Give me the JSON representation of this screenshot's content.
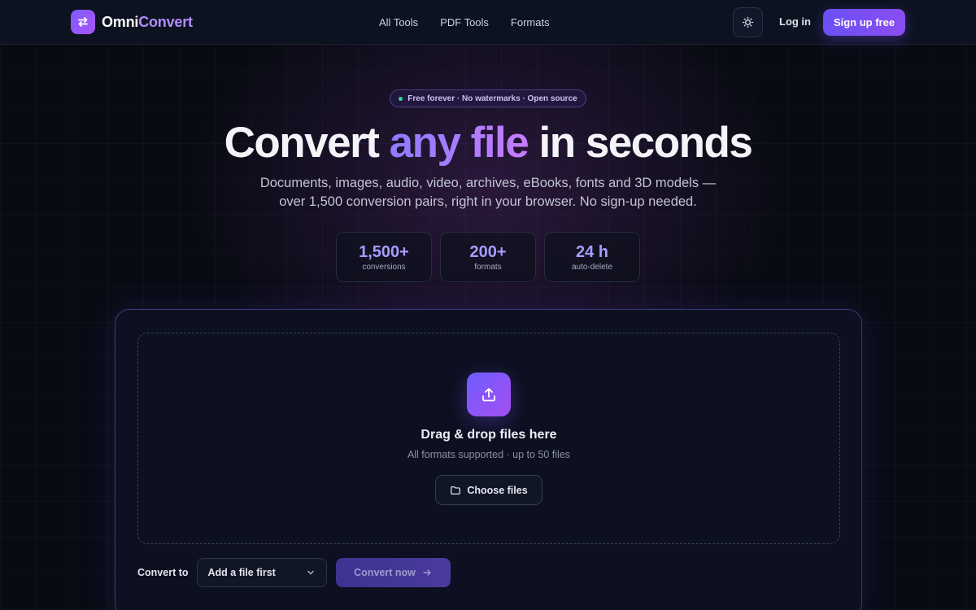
{
  "brand": {
    "name_part1": "Omni",
    "name_part2": "Convert",
    "logo_icon": "swap-arrows-icon"
  },
  "nav": {
    "links": [
      "All Tools",
      "PDF Tools",
      "Formats"
    ]
  },
  "header": {
    "theme_toggle_icon": "sun-icon",
    "login_label": "Log in",
    "signup_label": "Sign up free"
  },
  "hero": {
    "badge": "Free forever · No watermarks · Open source",
    "title_start": "Convert ",
    "title_accent": "any file",
    "title_end": " in seconds",
    "subtitle_line1": "Documents, images, audio, video, archives, eBooks, fonts and 3D models —",
    "subtitle_line2": "over 1,500 conversion pairs, right in your browser. No sign-up needed."
  },
  "stats": [
    {
      "value": "1,500+",
      "label": "conversions"
    },
    {
      "value": "200+",
      "label": "formats"
    },
    {
      "value": "24 h",
      "label": "auto-delete"
    }
  ],
  "upload": {
    "icon": "upload-icon",
    "title": "Drag & drop files here",
    "subtitle": "All formats supported · up to 50 files",
    "choose_label": "Choose files",
    "choose_icon": "folder-icon"
  },
  "convert": {
    "label": "Convert to",
    "select_value": "Add a file first",
    "button_label": "Convert now"
  },
  "colors": {
    "accent": "#7c5cff",
    "accent_secondary": "#a855f7",
    "background": "#090b14",
    "status_dot": "#34d399"
  }
}
